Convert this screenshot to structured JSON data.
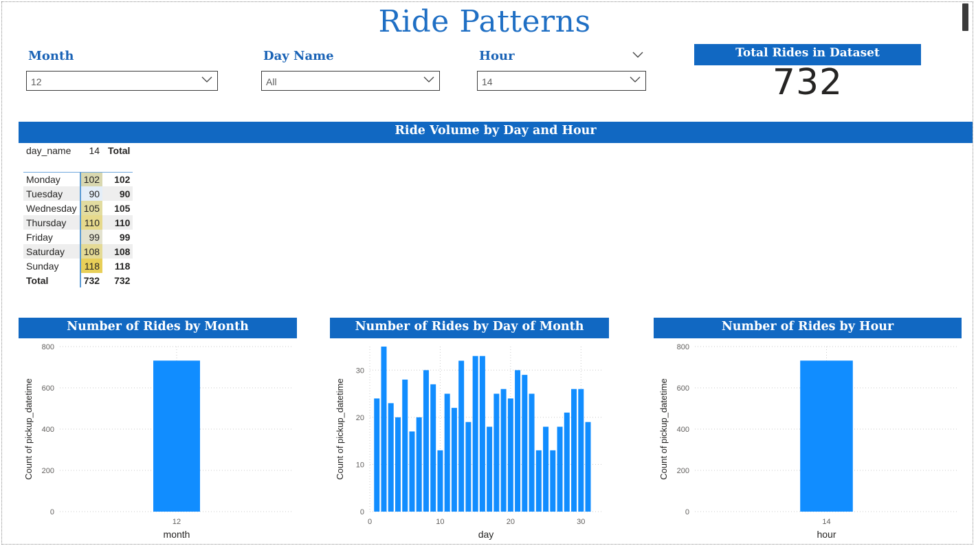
{
  "page": {
    "title": "Ride Patterns"
  },
  "slicers": [
    {
      "label": "Month",
      "value": "12",
      "show_header_chevron": false
    },
    {
      "label": "Day Name",
      "value": "All",
      "show_header_chevron": false
    },
    {
      "label": "Hour",
      "value": "14",
      "show_header_chevron": true
    }
  ],
  "kpi": {
    "label": "Total Rides in Dataset",
    "value": "732"
  },
  "matrix": {
    "title": "Ride Volume by Day and Hour",
    "headers": [
      "day_name",
      "14",
      "Total"
    ],
    "rows": [
      {
        "day": "Monday",
        "value": "102",
        "total": "102",
        "color": "#d9d8b0"
      },
      {
        "day": "Tuesday",
        "value": "90",
        "total": "90",
        "color": "#e4eef8"
      },
      {
        "day": "Wednesday",
        "value": "105",
        "total": "105",
        "color": "#e2dca0"
      },
      {
        "day": "Thursday",
        "value": "110",
        "total": "110",
        "color": "#e6d98c"
      },
      {
        "day": "Friday",
        "value": "99",
        "total": "99",
        "color": "#e3e2cf"
      },
      {
        "day": "Saturday",
        "value": "108",
        "total": "108",
        "color": "#e4da95"
      },
      {
        "day": "Sunday",
        "value": "118",
        "total": "118",
        "color": "#e8cf58"
      }
    ],
    "total_row": {
      "label": "Total",
      "value": "732",
      "total": "732"
    }
  },
  "colors": {
    "accent": "#1168c2",
    "bar": "#118dff",
    "title": "#1f6fc4"
  },
  "chart_data": [
    {
      "type": "bar",
      "title": "Number of Rides by Month",
      "xlabel": "month",
      "ylabel": "Count of pickup_datetime",
      "categories": [
        "12"
      ],
      "values": [
        732
      ],
      "ylim": [
        0,
        800
      ],
      "yticks": [
        0,
        200,
        400,
        600,
        800
      ],
      "grid": true
    },
    {
      "type": "bar",
      "title": "Number of Rides by Day of Month",
      "xlabel": "day",
      "ylabel": "Count of pickup_datetime",
      "x": [
        1,
        2,
        3,
        4,
        5,
        6,
        7,
        8,
        9,
        10,
        11,
        12,
        13,
        14,
        15,
        16,
        17,
        18,
        19,
        20,
        21,
        22,
        23,
        24,
        25,
        26,
        27,
        28,
        29,
        30,
        31
      ],
      "values": [
        24,
        35,
        23,
        20,
        28,
        17,
        20,
        30,
        27,
        13,
        25,
        22,
        32,
        19,
        33,
        33,
        18,
        25,
        26,
        24,
        30,
        29,
        25,
        13,
        18,
        13,
        18,
        21,
        26,
        26,
        19
      ],
      "xlim": [
        0,
        33
      ],
      "ylim": [
        0,
        35
      ],
      "xticks": [
        0,
        10,
        20,
        30
      ],
      "yticks": [
        0,
        10,
        20,
        30
      ],
      "grid": true
    },
    {
      "type": "bar",
      "title": "Number of Rides by Hour",
      "xlabel": "hour",
      "ylabel": "Count of pickup_datetime",
      "categories": [
        "14"
      ],
      "values": [
        732
      ],
      "ylim": [
        0,
        800
      ],
      "yticks": [
        0,
        200,
        400,
        600,
        800
      ],
      "grid": true
    }
  ]
}
